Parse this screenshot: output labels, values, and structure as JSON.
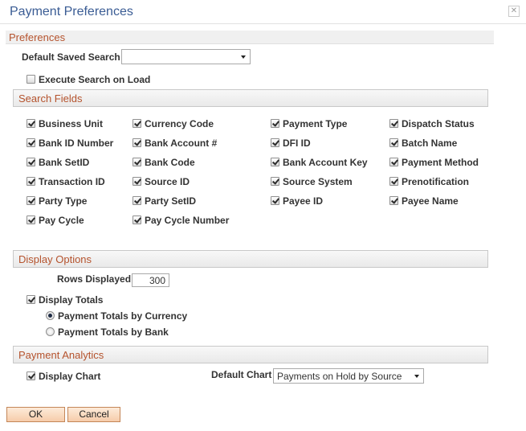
{
  "window": {
    "title": "Payment Preferences",
    "close_glyph": "✕",
    "close_icon": "close-icon"
  },
  "preferences": {
    "heading": "Preferences",
    "default_saved_search": {
      "label": "Default Saved Search",
      "value": ""
    },
    "execute_search_on_load": {
      "label": "Execute Search on Load",
      "checked": false
    }
  },
  "search_fields": {
    "heading": "Search Fields",
    "items": [
      {
        "label": "Business Unit",
        "checked": true
      },
      {
        "label": "Currency Code",
        "checked": true
      },
      {
        "label": "Payment Type",
        "checked": true
      },
      {
        "label": "Dispatch Status",
        "checked": true
      },
      {
        "label": "Bank ID Number",
        "checked": true
      },
      {
        "label": "Bank Account #",
        "checked": true
      },
      {
        "label": "DFI ID",
        "checked": true
      },
      {
        "label": "Batch Name",
        "checked": true
      },
      {
        "label": "Bank SetID",
        "checked": true
      },
      {
        "label": "Bank Code",
        "checked": true
      },
      {
        "label": "Bank Account Key",
        "checked": true
      },
      {
        "label": "Payment Method",
        "checked": true
      },
      {
        "label": "Transaction ID",
        "checked": true
      },
      {
        "label": "Source ID",
        "checked": true
      },
      {
        "label": "Source System",
        "checked": true
      },
      {
        "label": "Prenotification",
        "checked": true
      },
      {
        "label": "Party Type",
        "checked": true
      },
      {
        "label": "Party SetID",
        "checked": true
      },
      {
        "label": "Payee ID",
        "checked": true
      },
      {
        "label": "Payee Name",
        "checked": true
      },
      {
        "label": "Pay Cycle",
        "checked": true
      },
      {
        "label": "Pay Cycle Number",
        "checked": true
      }
    ]
  },
  "display_options": {
    "heading": "Display Options",
    "rows_displayed": {
      "label": "Rows Displayed",
      "value": "300"
    },
    "display_totals": {
      "label": "Display Totals",
      "checked": true
    },
    "totals_by_currency": {
      "label": "Payment Totals by Currency",
      "selected": true
    },
    "totals_by_bank": {
      "label": "Payment Totals by Bank",
      "selected": false
    }
  },
  "payment_analytics": {
    "heading": "Payment Analytics",
    "display_chart": {
      "label": "Display Chart",
      "checked": true
    },
    "default_chart": {
      "label": "Default Chart",
      "value": "Payments on Hold by Source"
    }
  },
  "buttons": {
    "ok": "OK",
    "cancel": "Cancel"
  }
}
